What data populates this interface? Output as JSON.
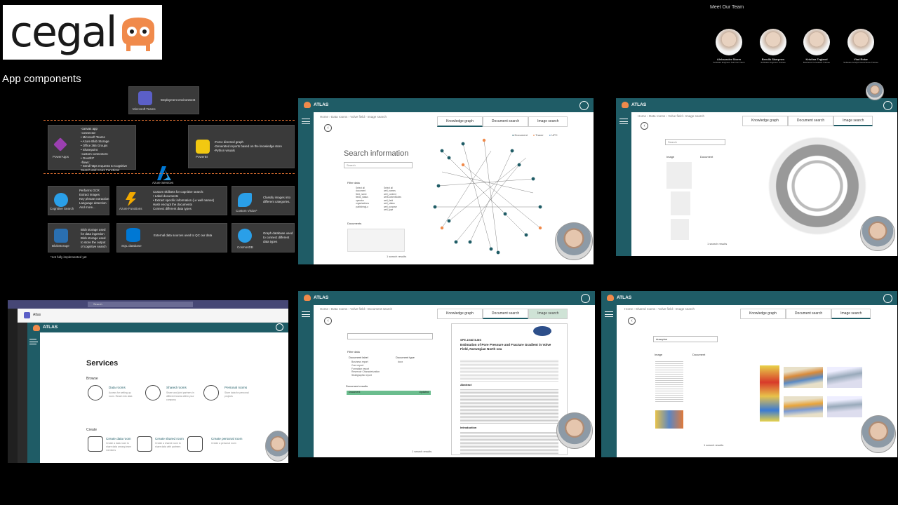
{
  "logo": {
    "text": "cegal"
  },
  "section_title": "App components",
  "team": {
    "title": "Meet Our Team",
    "members": [
      {
        "name": "Aleksander Storm",
        "role": "Software Engineer Summer Intern"
      },
      {
        "name": "Bendik Skarpnes",
        "role": "Software Engineer Trainee"
      },
      {
        "name": "Kristina Tegland",
        "role": "Business Consultant Trainee"
      },
      {
        "name": "Vlad Rotar",
        "role": "Software Analyst Geoscience Trainee"
      }
    ]
  },
  "diagram": {
    "teams": {
      "label": "Microsoft Teams",
      "text": "-Deployment environment"
    },
    "powerapps": {
      "label": "PowerApps",
      "text": "-canvas app\n-connector:\n  • Microsoft Teams\n  • Azure Blob Storage\n  • Office 365 Groups\n  • Sharepoint\n-custom connectors:\n  • OAuth2*\n-flows:\n  • Send https requests to Cognitive Search and Azure Functions"
    },
    "powerbi": {
      "label": "PowerBI",
      "text": "-Force directed graph\n-Generated reports based on the knowledge store\n-Python visuals"
    },
    "azure": {
      "label": "Azure Services"
    },
    "cognitive": {
      "label": "Cognitive Search",
      "text": "Performs OCR\nExtract images\nKey phrase extraction\nLanguage detection\nAnd more..."
    },
    "functions": {
      "label": "Azure Functions",
      "text": "Custom skillsets for cognitive search:\n  • Label documents\n  • Extract specific information (i.e well names)\nHash encrypt the documents\nConnect different data types"
    },
    "vision": {
      "label": "Custom Vision*",
      "text": "Classify images into different categories."
    },
    "blob": {
      "label": "BlobStorage",
      "text": "Blob storage used for data ingestion\nBlob storage used to store the output of cognitive search"
    },
    "sql": {
      "label": "SQL database",
      "text": "External data sources used to QC our data"
    },
    "cosmos": {
      "label": "CosmosDB",
      "text": "Graph database used to connect different data types"
    },
    "footnote": "*not fully implemented yet"
  },
  "app": {
    "name": "ATLAS",
    "tabs": [
      "Knowledge graph",
      "Document search",
      "Image search"
    ],
    "breadcrumbs_data": "Home  ›  Data rooms  ›  Volve field  ›  Image search",
    "breadcrumbs_doc": "Home  ›  Data rooms  ›  Volve field  ›  Document search",
    "breadcrumbs_shared": "Home  ›  Shared rooms  ›  Volve field  ›  Image search",
    "search_title": "Search information",
    "search_placeholder": "Search",
    "filter_data": "Filter data",
    "filter_options_left": [
      "Select all",
      "document",
      "field_name",
      "fields_status",
      "operator",
      "organizations",
      "publishingLo"
    ],
    "filter_options_right": [
      "Select all",
      "well_names",
      "well_content",
      "wellContentNotes",
      "well_field",
      "well_status",
      "well_purpose",
      "well_type"
    ],
    "documents_label": "Documents",
    "legend": [
      "Document",
      "Tracer",
      "UPC"
    ],
    "search_results": "1 search results",
    "image_col": "Image",
    "document_col": "Document",
    "doc_search_title": "Estimation of Pore Pressure and Fracture Gradient in Volve Field, Norwegian North sea",
    "doc_spe": "SPE-194678-MS",
    "doc_label": "Document label",
    "doc_type": "Document type",
    "doc_labels": [
      "Business report",
      "Core report",
      "Formation report",
      "Reservoir Characterization",
      "Stratigraphic report"
    ],
    "doc_types": [
      "docx"
    ],
    "doc_results": "Document results",
    "doc_results_cols": [
      "Document",
      "Updated"
    ],
    "abstract": "Abstract",
    "introduction": "Introduction",
    "image_search_query": "drawpine"
  },
  "services": {
    "window_title": "Atlas",
    "teams_search": "Search",
    "title": "Services",
    "browse": "Browse",
    "create": "Create",
    "items": [
      {
        "label": "Data rooms",
        "desc": "Access for setting up room. Reach into data"
      },
      {
        "label": "Shared rooms",
        "desc": "Share and joint partners in different teams within your company"
      },
      {
        "label": "Personal rooms",
        "desc": "Store data for personal projects"
      }
    ],
    "create_items": [
      {
        "label": "Create data room",
        "desc": "Create a data room to share data among team members"
      },
      {
        "label": "Create shared room",
        "desc": "Create a shared room to share data with partners"
      },
      {
        "label": "Create personal room",
        "desc": "Create a personal room"
      }
    ]
  },
  "colors": {
    "teal": "#1f5c66",
    "orange": "#f08a4b",
    "dash": "#e07030"
  }
}
